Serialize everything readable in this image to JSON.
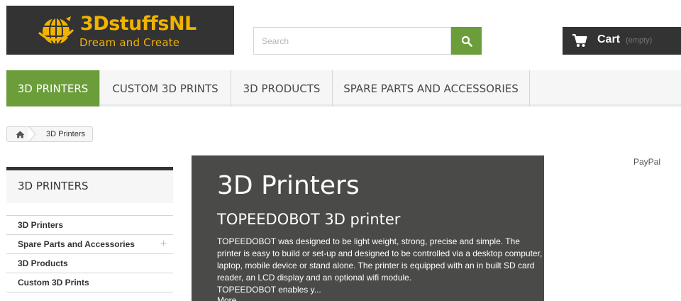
{
  "header": {
    "logo": {
      "title": "3DstuffsNL",
      "tagline": "Dream and Create",
      "brand_color": "#f1b300"
    },
    "search": {
      "placeholder": "Search",
      "button_icon": "search-icon",
      "accent": "#6b9e3b"
    },
    "cart": {
      "label": "Cart",
      "status": "(empty)",
      "icon": "cart-icon"
    }
  },
  "menu": {
    "items": [
      {
        "label": "3D PRINTERS",
        "active": true
      },
      {
        "label": "CUSTOM 3D PRINTS",
        "active": false
      },
      {
        "label": "3D PRODUCTS",
        "active": false
      },
      {
        "label": "SPARE PARTS AND ACCESSORIES",
        "active": false
      }
    ]
  },
  "breadcrumb": {
    "home_icon": "home-icon",
    "current": "3D Printers"
  },
  "sidebar": {
    "title": "3D PRINTERS",
    "items": [
      {
        "label": "3D Printers",
        "expandable": false
      },
      {
        "label": "Spare Parts and Accessories",
        "expandable": true,
        "expand_symbol": "+"
      },
      {
        "label": "3D Products",
        "expandable": false
      },
      {
        "label": "Custom 3D Prints",
        "expandable": false
      }
    ]
  },
  "category": {
    "title": "3D Printers",
    "subtitle": "TOPEEDOBOT 3D printer",
    "description": "TOPEEDOBOT was designed to be light weight, strong, precise and simple. The printer is easy to build or set-up and designed to be controlled via a desktop computer, laptop, mobile device or stand alone. The printer is equipped with an in built SD card reader, an LCD display and an optional wifi module.",
    "description_more": "TOPEEDOBOT enables y...",
    "more_link": "More"
  },
  "right_column": {
    "paypal": "PayPal"
  }
}
